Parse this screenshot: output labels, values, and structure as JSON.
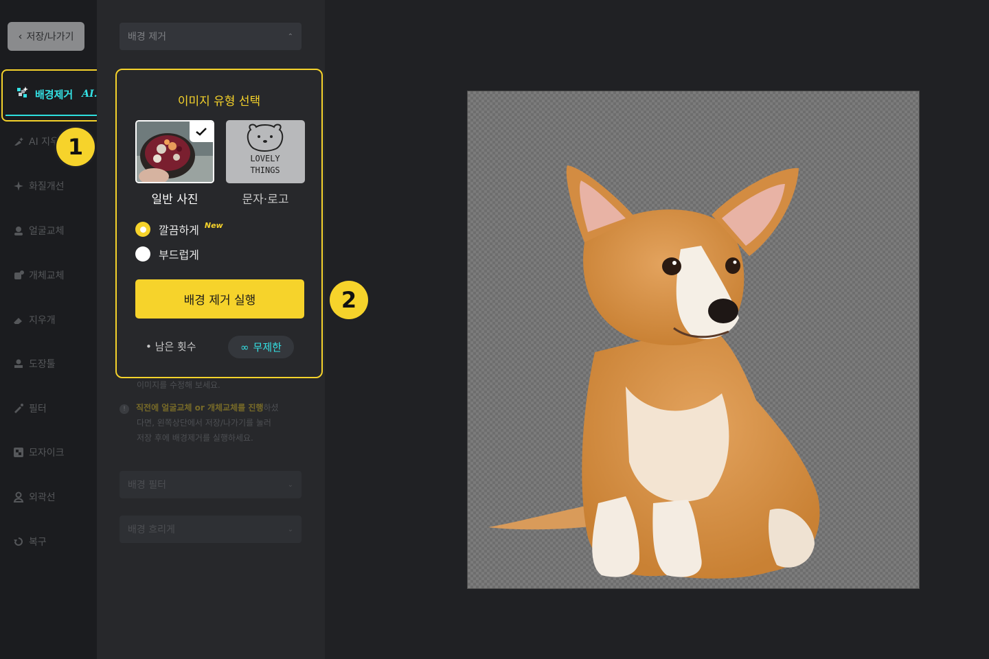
{
  "header": {
    "save_exit_label": "저장/나가기"
  },
  "sidebar": {
    "active_tool": {
      "label": "배경제거",
      "ai_tag": "AI."
    },
    "tools": [
      {
        "label": "AI 지우개",
        "icon": "eraser-spark-icon"
      },
      {
        "label": "화질개선",
        "icon": "sparkle-icon"
      },
      {
        "label": "얼굴교체",
        "icon": "face-swap-icon"
      },
      {
        "label": "개체교체",
        "icon": "object-swap-icon"
      },
      {
        "label": "지우개",
        "icon": "eraser-icon"
      },
      {
        "label": "도장툴",
        "icon": "stamp-icon"
      },
      {
        "label": "필터",
        "icon": "filter-icon"
      },
      {
        "label": "모자이크",
        "icon": "mosaic-icon"
      },
      {
        "label": "외곽선",
        "icon": "outline-icon"
      },
      {
        "label": "복구",
        "icon": "restore-icon"
      }
    ]
  },
  "badges": {
    "step1": "1",
    "step2": "2"
  },
  "panel": {
    "section_dropdown": "배경 제거",
    "popover": {
      "title": "이미지 유형 선택",
      "types": [
        {
          "label": "일반 사진",
          "selected": true
        },
        {
          "label": "문자·로고",
          "selected": false
        }
      ],
      "logo_preview_text": [
        "LOVELY",
        "THINGS"
      ],
      "modes": [
        {
          "label": "깔끔하게",
          "tag": "New",
          "selected": true
        },
        {
          "label": "부드럽게",
          "tag": "",
          "selected": false
        }
      ],
      "run_label": "배경 제거 실행",
      "remaining_label": "• 남은 횟수",
      "unlimited_symbol": "∞",
      "unlimited_label": "무제한"
    },
    "help_line1": "이미지를 수정해 보세요.",
    "notice": {
      "highlight": "직전에 얼굴교체 or 개체교체를 진행",
      "rest1": "하셨",
      "line2": "다면, 왼쪽상단에서 저장/나가기를 눌러",
      "line3": "저장 후에 배경제거를 실행하세요."
    },
    "filter_dropdown": "배경 필터",
    "blur_dropdown": "배경 흐리게"
  },
  "colors": {
    "accent_yellow": "#f6d32b",
    "accent_cyan": "#34e3e6",
    "bg": "#202124"
  }
}
